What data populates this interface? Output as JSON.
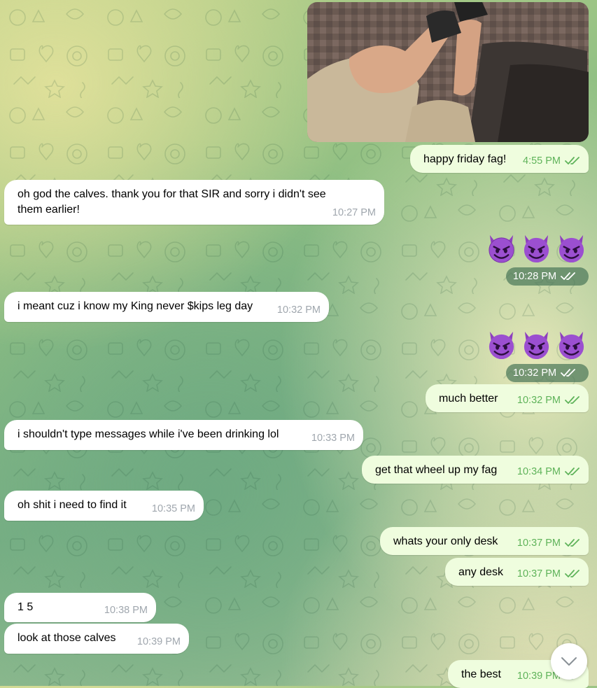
{
  "chat": {
    "messages": [
      {
        "dir": "out",
        "text": "happy friday fag!",
        "time": "4:55 PM"
      },
      {
        "dir": "in",
        "text": "oh god the calves.  thank you for that SIR and sorry i didn't see them earlier!",
        "time": "10:27 PM"
      },
      {
        "dir": "out",
        "text": "😈😈😈",
        "time": "10:28 PM"
      },
      {
        "dir": "in",
        "text": "i meant cuz i know my King never $kips leg day",
        "time": "10:32 PM"
      },
      {
        "dir": "out",
        "text": "😈😈😈",
        "time": "10:32 PM"
      },
      {
        "dir": "out",
        "text": "much better",
        "time": "10:32 PM"
      },
      {
        "dir": "in",
        "text": "i shouldn't type messages while i've been drinking lol",
        "time": "10:33 PM"
      },
      {
        "dir": "out",
        "text": "get that wheel up my fag",
        "time": "10:34 PM"
      },
      {
        "dir": "in",
        "text": "oh shit i need to find it",
        "time": "10:35 PM"
      },
      {
        "dir": "out",
        "text": "whats your only desk",
        "time": "10:37 PM"
      },
      {
        "dir": "out",
        "text": "any desk",
        "time": "10:37 PM"
      },
      {
        "dir": "in",
        "text": "1 5",
        "time": "10:38 PM"
      },
      {
        "dir": "in",
        "text": "look at those calves",
        "time": "10:39 PM"
      },
      {
        "dir": "out",
        "text": "the best",
        "time": "10:39 PM"
      }
    ]
  },
  "icons": {
    "read_receipt": "double-check-icon",
    "emoji": "smiling-face-with-horns-icon",
    "scroll": "chevron-down-icon"
  },
  "colors": {
    "outgoing_bubble": "#effdde",
    "incoming_bubble": "#ffffff",
    "outgoing_meta": "#5fb35a",
    "incoming_meta": "#a0a7ae",
    "sticker_pill": "#4c785a"
  }
}
